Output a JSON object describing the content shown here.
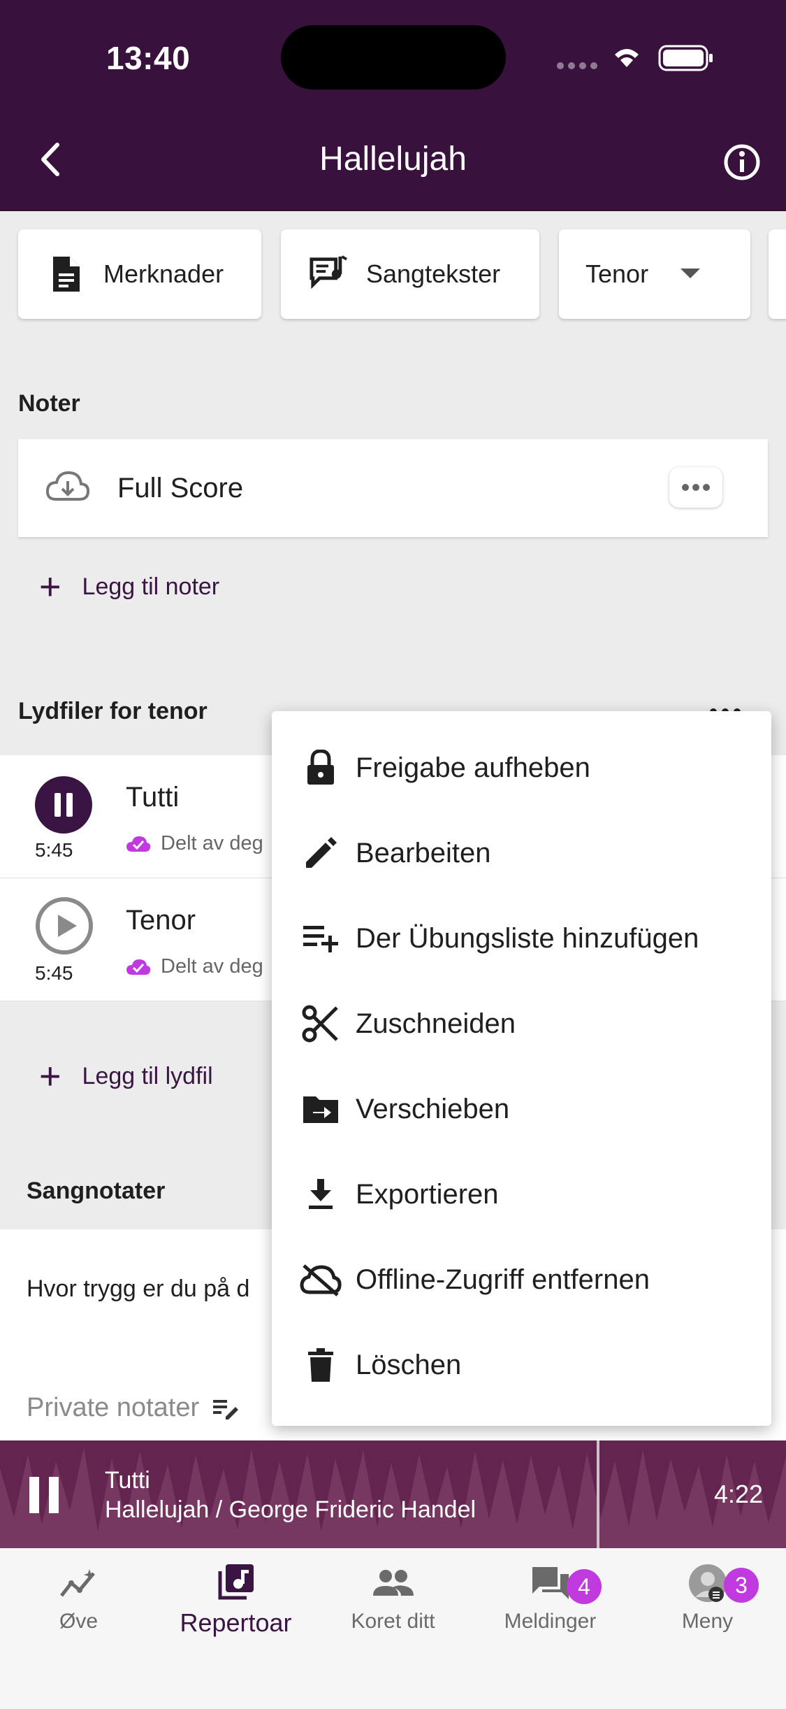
{
  "status": {
    "time": "13:40"
  },
  "header": {
    "title": "Hallelujah"
  },
  "chips": {
    "notes_label": "Merknader",
    "lyrics_label": "Sangtekster",
    "voice_label": "Tenor"
  },
  "scores": {
    "section_title": "Noter",
    "items": [
      {
        "name": "Full Score"
      }
    ],
    "add_label": "Legg til noter"
  },
  "audio": {
    "section_title": "Lydfiler for tenor",
    "items": [
      {
        "title": "Tutti",
        "duration": "5:45",
        "shared": "Delt av deg"
      },
      {
        "title": "Tenor",
        "duration": "5:45",
        "shared": "Delt av deg"
      }
    ],
    "add_label": "Legg til lydfil"
  },
  "song_notes": {
    "section_title": "Sangnotater",
    "question": "Hvor trygg er du på d",
    "private_placeholder": "Private notater"
  },
  "context_menu": {
    "items": [
      {
        "label": "Freigabe aufheben",
        "icon": "lock-icon"
      },
      {
        "label": "Bearbeiten",
        "icon": "pencil-icon"
      },
      {
        "label": "Der Übungsliste hinzufügen",
        "icon": "playlist-add-icon"
      },
      {
        "label": "Zuschneiden",
        "icon": "scissors-icon"
      },
      {
        "label": "Verschieben",
        "icon": "folder-move-icon"
      },
      {
        "label": "Exportieren",
        "icon": "download-icon"
      },
      {
        "label": "Offline-Zugriff entfernen",
        "icon": "cloud-off-icon"
      },
      {
        "label": "Löschen",
        "icon": "trash-icon"
      }
    ]
  },
  "player": {
    "track": "Tutti",
    "subtitle": "Hallelujah / George Frideric Handel",
    "time": "4:22"
  },
  "tabs": [
    {
      "label": "Øve",
      "icon": "practice-icon"
    },
    {
      "label": "Repertoar",
      "icon": "music-note-icon",
      "active": true
    },
    {
      "label": "Koret ditt",
      "icon": "group-icon"
    },
    {
      "label": "Meldinger",
      "icon": "chat-icon",
      "badge": "4"
    },
    {
      "label": "Meny",
      "icon": "avatar",
      "badge": "3"
    }
  ],
  "colors": {
    "header_bg": "#38123d",
    "accent": "#3a1442",
    "badge": "#c13ae0",
    "player_bg": "#63254f"
  }
}
